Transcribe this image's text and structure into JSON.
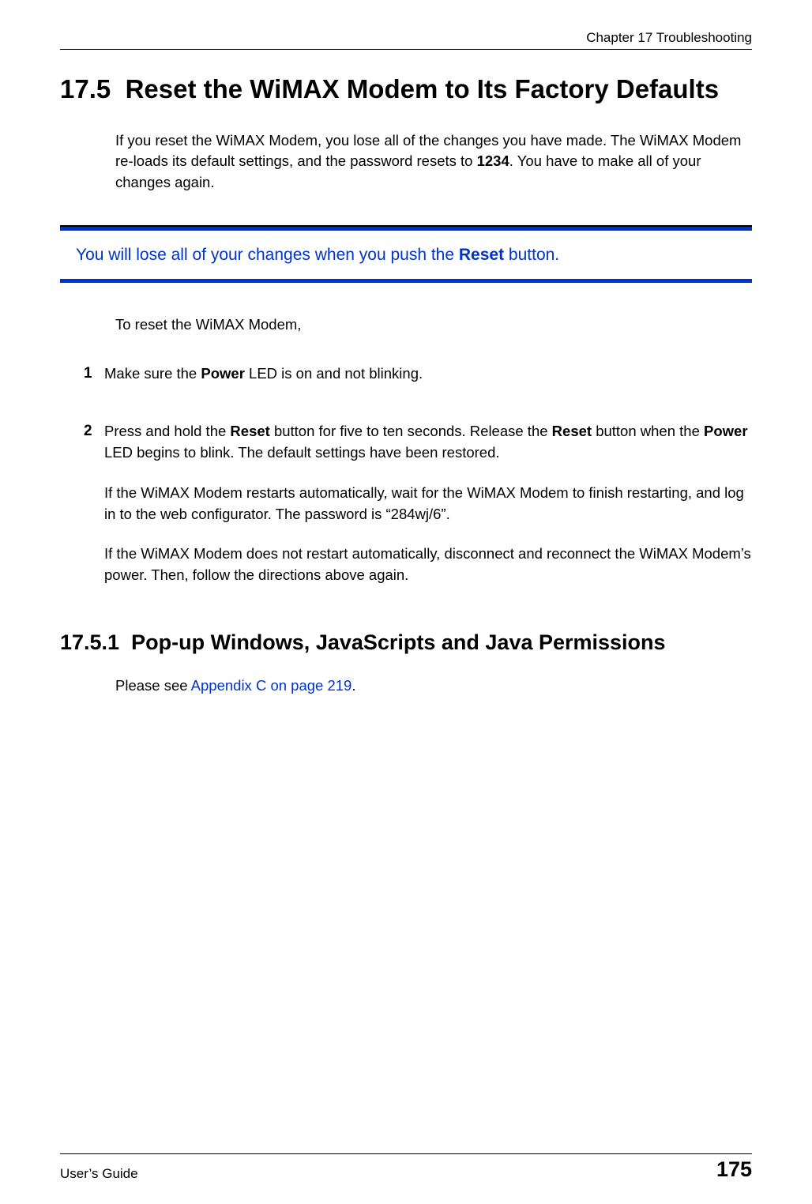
{
  "header": {
    "chapter": "Chapter 17 Troubleshooting"
  },
  "section": {
    "number": "17.5",
    "title": "Reset the WiMAX Modem to Its Factory Defaults"
  },
  "intro": {
    "text_before_pwd": "If you reset the WiMAX Modem, you lose all of the changes you have made. The WiMAX Modem re-loads its default settings, and the password resets to ",
    "password": "1234",
    "text_after_pwd": ". You have to make all of your changes again."
  },
  "callout": {
    "before_bold": "You will lose all of your changes when you push the ",
    "bold_word": "Reset",
    "after_bold": " button."
  },
  "subintro": "To reset the WiMAX Modem,",
  "steps": [
    {
      "num": "1",
      "parts": {
        "a": "Make sure the ",
        "b_bold": "Power",
        "c": " LED is on and not blinking."
      }
    },
    {
      "num": "2",
      "parts": {
        "a": "Press and hold the ",
        "b_bold": "Reset",
        "c": " button for five to ten seconds. Release the ",
        "d_bold": "Reset",
        "e": " button when the ",
        "f_bold": "Power",
        "g": " LED begins to blink. The default settings have been restored."
      }
    }
  ],
  "post_steps": {
    "p1": "If the WiMAX Modem restarts automatically, wait for the WiMAX Modem to finish restarting, and log in to the web configurator. The password is “284wj/6”.",
    "p2": "If the WiMAX Modem does not restart automatically, disconnect and reconnect the WiMAX Modem’s power. Then, follow the directions above again."
  },
  "subsection": {
    "number": "17.5.1",
    "title": "Pop-up Windows, JavaScripts and Java Permissions"
  },
  "appendix": {
    "before_link": "Please see ",
    "link_text": "Appendix C on page 219",
    "after_link": "."
  },
  "footer": {
    "left": "User’s Guide",
    "page": "175"
  }
}
